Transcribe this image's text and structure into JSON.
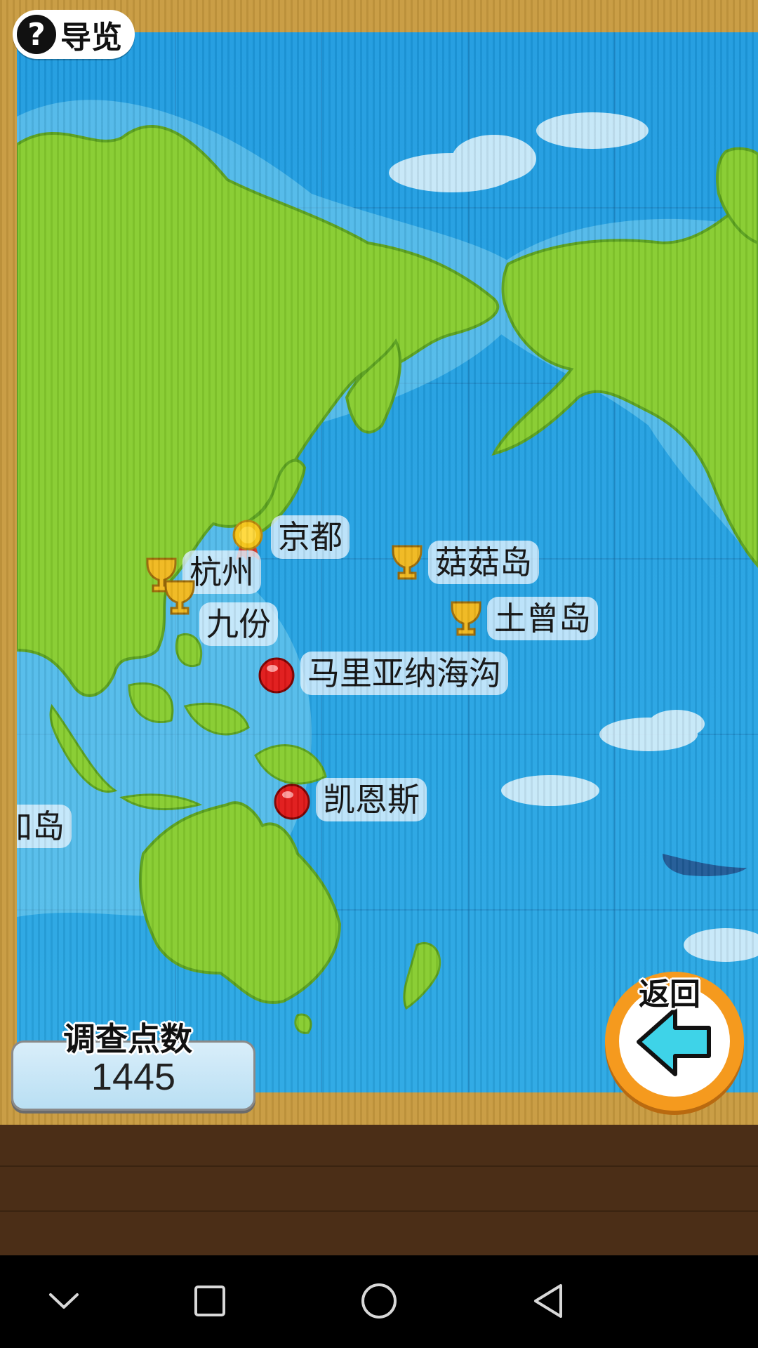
{
  "top": {
    "guide_icon": "question-icon",
    "guide_glyph": "?",
    "guide_label": "导览"
  },
  "places": [
    {
      "name": "京都",
      "marker": "gold-medal-icon"
    },
    {
      "name": "杭州",
      "marker": "gold-trophy-icon"
    },
    {
      "name": "九份",
      "marker": "gold-trophy-icon"
    },
    {
      "name": "菇菇岛",
      "marker": "gold-trophy-icon"
    },
    {
      "name": "土曾岛",
      "marker": "gold-trophy-icon"
    },
    {
      "name": "马里亚纳海沟",
      "marker": "red-dot-icon"
    },
    {
      "name": "凯恩斯",
      "marker": "red-dot-icon"
    },
    {
      "name": "加岛",
      "marker": "none"
    }
  ],
  "score": {
    "title": "调查点数",
    "value": "1445"
  },
  "back": {
    "label": "返回",
    "icon": "arrow-left-icon"
  },
  "navbar": {
    "items": [
      "chevron-down-icon",
      "square-icon",
      "circle-icon",
      "triangle-back-icon"
    ]
  },
  "colors": {
    "ocean": "#2aa3e0",
    "land": "#86cc2e",
    "frame": "#c89a3f",
    "wood": "#4b2e17",
    "back_ring": "#f59a1e",
    "arrow": "#3ed3e8"
  }
}
